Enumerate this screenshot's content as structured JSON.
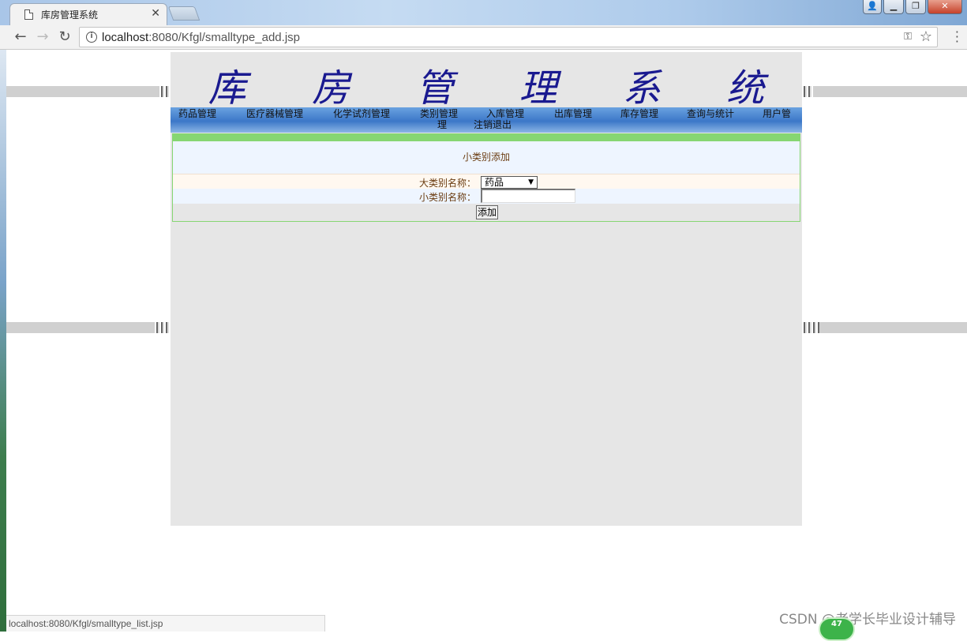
{
  "browser": {
    "tab_title": "库房管理系统",
    "url_host": "localhost",
    "url_rest": ":8080/Kfgl/smalltype_add.jsp",
    "status_url": "localhost:8080/Kfgl/smalltype_list.jsp"
  },
  "site": {
    "title": "库 房 管 理 系 统",
    "menu": [
      "药品管理",
      "医疗器械管理",
      "化学试剂管理",
      "类别管理",
      "理",
      "入库管理",
      "出库管理",
      "库存管理",
      "查询与统计",
      "用户管",
      "注销退出"
    ]
  },
  "form": {
    "heading": "小类别添加",
    "big_type_label": "大类别名称：",
    "big_type_value": "药品",
    "small_type_label": "小类别名称：",
    "small_type_value": "",
    "submit_label": "添加"
  },
  "overlay": {
    "watermark": "CSDN @老学长毕业设计辅导",
    "badge": "47"
  }
}
